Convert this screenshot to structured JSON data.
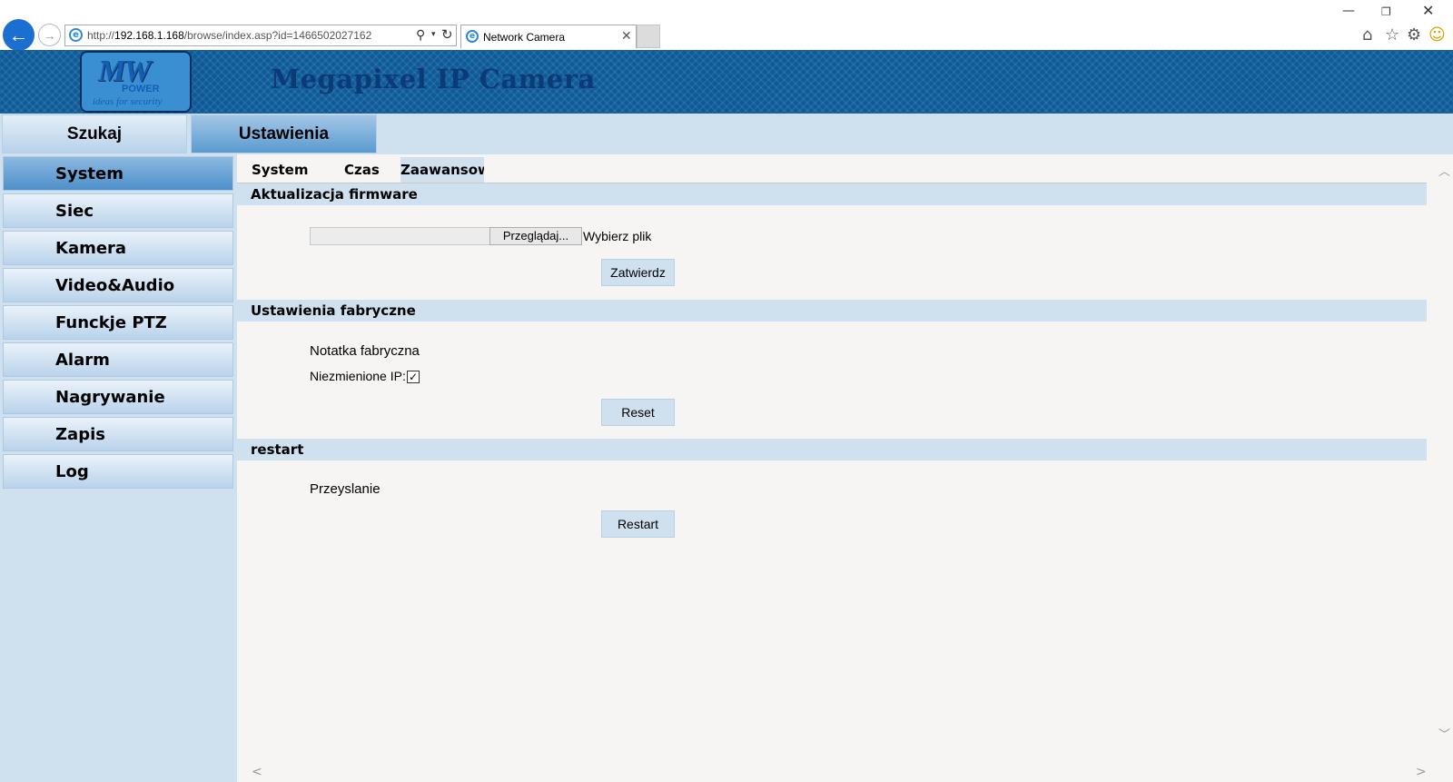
{
  "browser": {
    "url_prefix": "http://",
    "url_host": "192.168.1.168",
    "url_path": "/browse/index.asp?id=1466502027162",
    "tab_title": "Network Camera",
    "back_icon": "back-arrow-icon",
    "forward_icon": "forward-arrow-icon",
    "ie_icon_glyph": "e",
    "search_glyph": "⚲",
    "dropdown_glyph": "▾",
    "refresh_glyph": "↻",
    "close_glyph": "✕",
    "min_glyph": "—",
    "restore_glyph": "❐",
    "home_glyph": "⌂",
    "star_glyph": "☆",
    "gear_glyph": "⚙",
    "smiley_glyph": "☺"
  },
  "banner": {
    "logo_mw": "MW",
    "logo_power": "POWER",
    "logo_tagline": "ideas for security",
    "title": "Megapixel IP Camera",
    "colors": {
      "banner": "#0d5a98",
      "title": "#0c3a76"
    }
  },
  "top_tabs": [
    {
      "label": "Szukaj"
    },
    {
      "label": "Ustawienia",
      "active": true
    }
  ],
  "sidebar": {
    "items": [
      {
        "label": "System",
        "active": true
      },
      {
        "label": "Siec"
      },
      {
        "label": "Kamera"
      },
      {
        "label": "Video&Audio"
      },
      {
        "label": "Funckje PTZ"
      },
      {
        "label": "Alarm"
      },
      {
        "label": "Nagrywanie"
      },
      {
        "label": "Zapis"
      },
      {
        "label": "Log"
      }
    ]
  },
  "sub_tabs": [
    {
      "label": "System"
    },
    {
      "label": "Czas"
    },
    {
      "label": "Zaawansow",
      "active": true
    }
  ],
  "firmware": {
    "heading": "Aktualizacja firmware",
    "browse_label": "Przeglądaj...",
    "file_status": "Wybierz plik",
    "submit_label": "Zatwierdz"
  },
  "factory": {
    "heading": "Ustawienia fabryczne",
    "note": "Notatka fabryczna",
    "keep_ip_label": "Niezmienione IP:",
    "keep_ip_checked": true,
    "check_glyph": "✓",
    "reset_label": "Reset"
  },
  "restart": {
    "heading": "restart",
    "text": "Przeyslanie",
    "button_label": "Restart"
  },
  "scroll": {
    "up_glyph": "︿",
    "down_glyph": "﹀",
    "left_glyph": "<",
    "right_glyph": ">"
  },
  "colors": {
    "light_panel": "#cfe0ef",
    "content_bg": "#f6f5f4",
    "active_tab": "#5a9bd0"
  }
}
